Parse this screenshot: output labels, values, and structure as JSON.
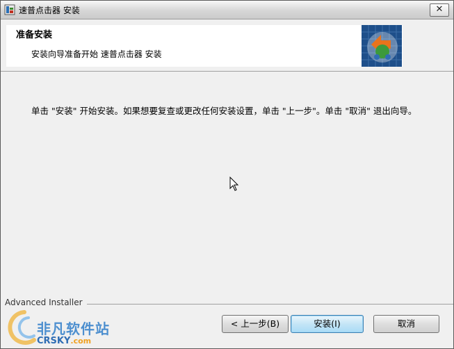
{
  "window": {
    "title": "速普点击器 安装",
    "close_label": "✕"
  },
  "header": {
    "title": "准备安装",
    "subtitle": "安装向导准备开始 速普点击器 安装"
  },
  "body": {
    "message": "单击 \"安装\" 开始安装。如果想要复查或更改任何安装设置，单击 \"上一步\"。单击 \"取消\" 退出向导。"
  },
  "footer": {
    "brand": "Advanced Installer",
    "back_label": "< 上一步(B)",
    "install_label": "安装(I)",
    "cancel_label": "取消"
  },
  "watermark": {
    "cn": "非凡软件站",
    "en": "CRSKY",
    "domain": ".com"
  },
  "colors": {
    "accent": "#3c7fb1",
    "watermark": "#4d8fcf"
  }
}
